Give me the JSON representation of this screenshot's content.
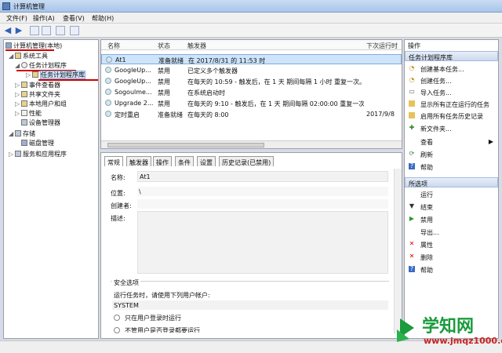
{
  "window": {
    "title": "计算机管理"
  },
  "menu": [
    "文件(F)",
    "操作(A)",
    "查看(V)",
    "帮助(H)"
  ],
  "tree": {
    "root": "计算机管理(本地)",
    "system_tools": "系统工具",
    "task_scheduler": "任务计划程序",
    "task_library": "任务计划程序库",
    "event_viewer": "事件查看器",
    "shared_folders": "共享文件夹",
    "local_users": "本地用户和组",
    "performance": "性能",
    "device_manager": "设备管理器",
    "storage": "存储",
    "disk_mgmt": "磁盘管理",
    "services_apps": "服务和应用程序"
  },
  "list": {
    "columns": [
      "名称",
      "状态",
      "触发器",
      "下次运行时"
    ],
    "rows": [
      {
        "name": "At1",
        "status": "准备就绪",
        "trigger": "在 2017/8/31 的 11:53 时",
        "next": ""
      },
      {
        "name": "GoogleUp...",
        "status": "禁用",
        "trigger": "已定义多个触发器",
        "next": ""
      },
      {
        "name": "GoogleUp...",
        "status": "禁用",
        "trigger": "在每天的 10:59 - 触发后，在 1 天 期间每隔 1 小时 重复一次。",
        "next": ""
      },
      {
        "name": "Sogoulme...",
        "status": "禁用",
        "trigger": "在系统启动时",
        "next": ""
      },
      {
        "name": "Upgrade 2...",
        "status": "禁用",
        "trigger": "在每天的 9:10 - 触发后，在 1 天 期间每隔 02:00:00 重复一次。",
        "next": ""
      },
      {
        "name": "定时重启",
        "status": "准备就绪",
        "trigger": "在每天的 8:00",
        "next": "2017/9/8"
      }
    ]
  },
  "detail": {
    "tabs": [
      "常规",
      "触发器",
      "操作",
      "条件",
      "设置",
      "历史记录(已禁用)"
    ],
    "name_label": "名称:",
    "name_value": "At1",
    "location_label": "位置:",
    "location_value": "\\",
    "author_label": "创建者:",
    "description_label": "描述:",
    "security_title": "安全选项",
    "run_as_text": "运行任务时，请使用下列用户帐户:",
    "account": "SYSTEM",
    "radio1": "只在用户登录时运行",
    "radio2": "不管用户是否登录都要运行"
  },
  "actions": {
    "header": "操作",
    "section1": "任务计划程序库",
    "items1": [
      {
        "icon": "create-basic-task-icon",
        "label": "创建基本任务..."
      },
      {
        "icon": "create-task-icon",
        "label": "创建任务..."
      },
      {
        "icon": "import-task-icon",
        "label": "导入任务..."
      },
      {
        "icon": "show-running-tasks-icon",
        "label": "显示所有正在运行的任务"
      },
      {
        "icon": "enable-history-icon",
        "label": "启用所有任务历史记录"
      },
      {
        "icon": "new-folder-icon",
        "label": "新文件夹..."
      },
      {
        "icon": "view-icon",
        "label": "查看"
      },
      {
        "icon": "refresh-icon",
        "label": "刷新"
      },
      {
        "icon": "help-icon",
        "label": "帮助"
      }
    ],
    "section2": "所选项",
    "items2": [
      {
        "icon": "run-icon",
        "label": "运行"
      },
      {
        "icon": "end-icon",
        "label": "结束"
      },
      {
        "icon": "disable-icon",
        "label": "禁用"
      },
      {
        "icon": "export-icon",
        "label": "导出..."
      },
      {
        "icon": "properties-icon",
        "label": "属性"
      },
      {
        "icon": "delete-icon",
        "label": "删除"
      },
      {
        "icon": "help-icon",
        "label": "帮助"
      }
    ]
  },
  "watermark": {
    "cn": "学知网",
    "url": "www.jmqz1000.com"
  },
  "colors": {
    "annotation_red": "#d00000",
    "selection": "#cde4fb",
    "watermark_green": "#1a9b3c"
  }
}
